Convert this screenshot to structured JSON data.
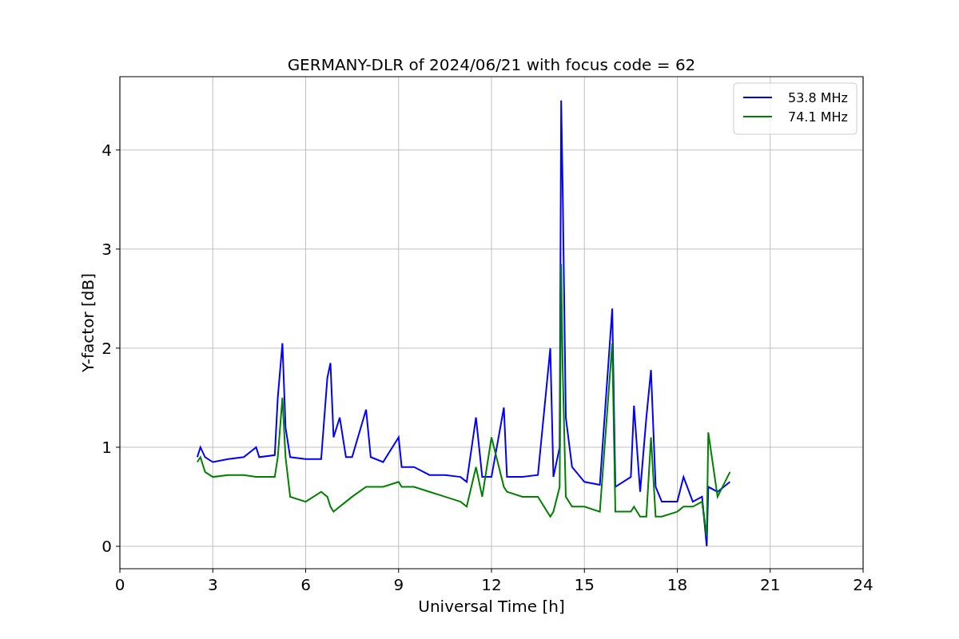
{
  "figure": {
    "chart_data": {
      "type": "line",
      "title": "GERMANY-DLR of 2024/06/21 with focus code = 62",
      "xlabel": "Universal Time [h]",
      "ylabel": "Y-factor [dB]",
      "xlim": [
        0,
        24
      ],
      "ylim": [
        -0.226,
        4.74
      ],
      "xticks": [
        0,
        3,
        6,
        9,
        12,
        15,
        18,
        21,
        24
      ],
      "yticks": [
        0,
        1,
        2,
        3,
        4
      ],
      "grid": true,
      "legend": true,
      "x": [
        2.5,
        2.6,
        2.75,
        3,
        3.5,
        4,
        4.4,
        4.5,
        5,
        5.1,
        5.25,
        5.35,
        5.5,
        6,
        6.5,
        6.7,
        6.8,
        6.9,
        7.1,
        7.3,
        7.5,
        7.95,
        8.1,
        8.5,
        9,
        9.1,
        9.5,
        10,
        10.5,
        11,
        11.2,
        11.5,
        11.7,
        12,
        12.4,
        12.5,
        13,
        13.5,
        13.9,
        14,
        14.2,
        14.25,
        14.3,
        14.4,
        14.6,
        15,
        15.5,
        15.9,
        16,
        16.5,
        16.6,
        16.8,
        17,
        17.15,
        17.3,
        17.5,
        18,
        18.2,
        18.5,
        18.8,
        18.95,
        19,
        19.3,
        19.7
      ],
      "series": [
        {
          "name": "53.8 MHz",
          "color": "#0000ff",
          "values": [
            0.9,
            1.0,
            0.9,
            0.85,
            0.88,
            0.9,
            1.0,
            0.9,
            0.92,
            1.5,
            2.05,
            1.2,
            0.9,
            0.88,
            0.88,
            1.7,
            1.85,
            1.1,
            1.3,
            0.9,
            0.9,
            1.38,
            0.9,
            0.85,
            1.1,
            0.8,
            0.8,
            0.72,
            0.72,
            0.7,
            0.65,
            1.3,
            0.7,
            0.7,
            1.4,
            0.7,
            0.7,
            0.72,
            2.0,
            0.7,
            1.0,
            4.5,
            3.6,
            1.3,
            0.8,
            0.65,
            0.62,
            2.4,
            0.6,
            0.7,
            1.42,
            0.55,
            1.3,
            1.78,
            0.6,
            0.45,
            0.45,
            0.7,
            0.45,
            0.5,
            0.0,
            0.6,
            0.55,
            0.65
          ]
        },
        {
          "name": "74.1 MHz",
          "color": "#008000",
          "values": [
            0.85,
            0.9,
            0.75,
            0.7,
            0.72,
            0.72,
            0.7,
            0.7,
            0.7,
            0.9,
            1.5,
            0.9,
            0.5,
            0.45,
            0.55,
            0.5,
            0.4,
            0.35,
            0.4,
            0.45,
            0.5,
            0.6,
            0.6,
            0.6,
            0.65,
            0.6,
            0.6,
            0.55,
            0.5,
            0.45,
            0.4,
            0.8,
            0.5,
            1.1,
            0.6,
            0.55,
            0.5,
            0.5,
            0.3,
            0.35,
            0.6,
            2.85,
            1.8,
            0.5,
            0.4,
            0.4,
            0.35,
            2.05,
            0.35,
            0.35,
            0.4,
            0.3,
            0.3,
            1.1,
            0.3,
            0.3,
            0.35,
            0.4,
            0.4,
            0.45,
            0.1,
            1.15,
            0.5,
            0.75
          ]
        }
      ]
    }
  }
}
